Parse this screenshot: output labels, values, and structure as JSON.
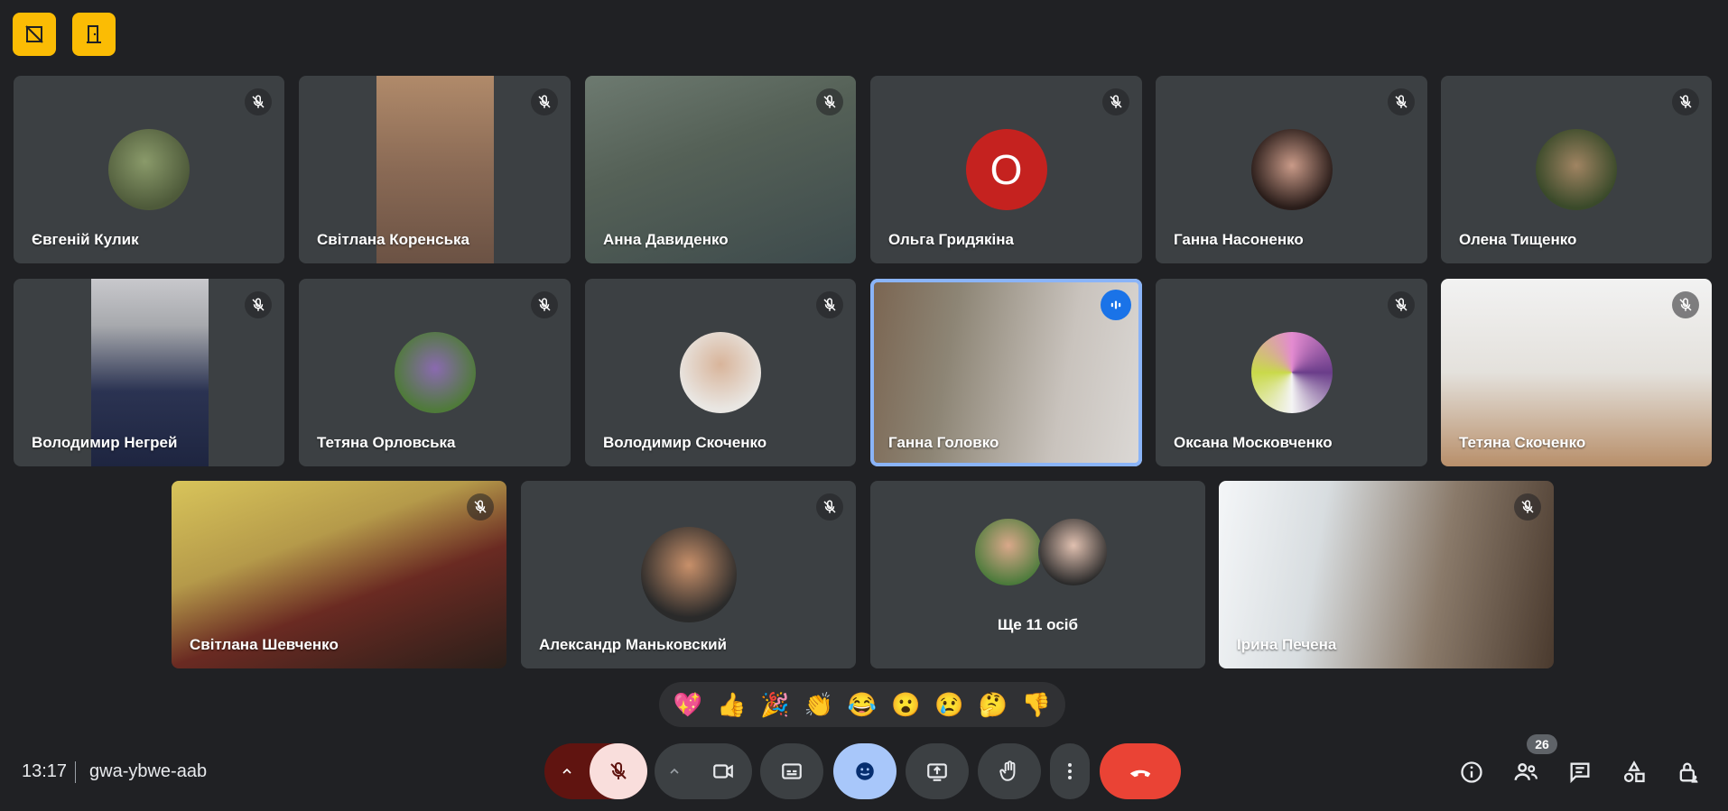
{
  "top_buttons": [
    {
      "icon": "hide-tiles-icon"
    },
    {
      "icon": "door-icon"
    }
  ],
  "tiles": [
    {
      "name": "Євгеній Кулик",
      "muted": true,
      "kind": "avatar"
    },
    {
      "name": "Світлана Коренська",
      "muted": true,
      "kind": "video"
    },
    {
      "name": "Анна Давиденко",
      "muted": true,
      "kind": "video"
    },
    {
      "name": "Ольга Гридякіна",
      "muted": true,
      "kind": "letter",
      "letter": "О"
    },
    {
      "name": "Ганна Насоненко",
      "muted": true,
      "kind": "avatar"
    },
    {
      "name": "Олена Тищенко",
      "muted": true,
      "kind": "avatar"
    },
    {
      "name": "Володимир Негрей",
      "muted": true,
      "kind": "video"
    },
    {
      "name": "Тетяна Орловська",
      "muted": true,
      "kind": "avatar"
    },
    {
      "name": "Володимир Скоченко",
      "muted": true,
      "kind": "avatar"
    },
    {
      "name": "Ганна Головко",
      "muted": false,
      "speaking": true,
      "kind": "video"
    },
    {
      "name": "Оксана Московченко",
      "muted": true,
      "kind": "avatar"
    },
    {
      "name": "Тетяна Скоченко",
      "muted": true,
      "kind": "video"
    },
    {
      "name": "Світлана Шевченко",
      "muted": true,
      "kind": "video"
    },
    {
      "name": "Александр Маньковский",
      "muted": true,
      "kind": "avatar"
    },
    {
      "name": "Ірина Печена",
      "muted": true,
      "kind": "video"
    }
  ],
  "more_tile": {
    "label": "Ще 11 осіб"
  },
  "reactions": [
    "💖",
    "👍",
    "🎉",
    "👏",
    "😂",
    "😮",
    "😢",
    "🤔",
    "👎"
  ],
  "meeting": {
    "time": "13:17",
    "code": "gwa-ybwe-aab"
  },
  "participants_count": "26",
  "colors": {
    "background": "#202124",
    "tile": "#3c4043",
    "accent": "#8ab4f8",
    "end_call": "#ea4335",
    "highlight": "#fbbc04"
  }
}
